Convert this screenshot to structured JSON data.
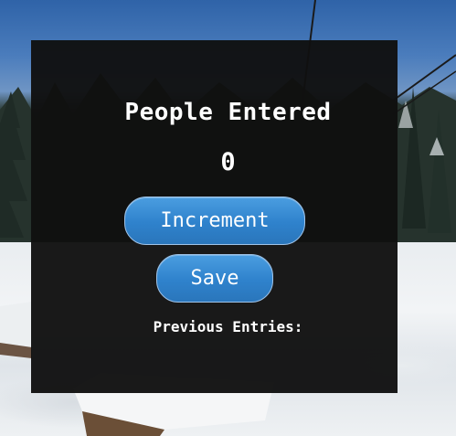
{
  "counter": {
    "title": "People Entered",
    "count": "0",
    "increment_label": "Increment",
    "save_label": "Save",
    "previous_entries_label": "Previous Entries:",
    "previous_entries": []
  },
  "colors": {
    "panel_background": "#101010",
    "button_blue": "#2f82cc",
    "text": "#ffffff"
  }
}
